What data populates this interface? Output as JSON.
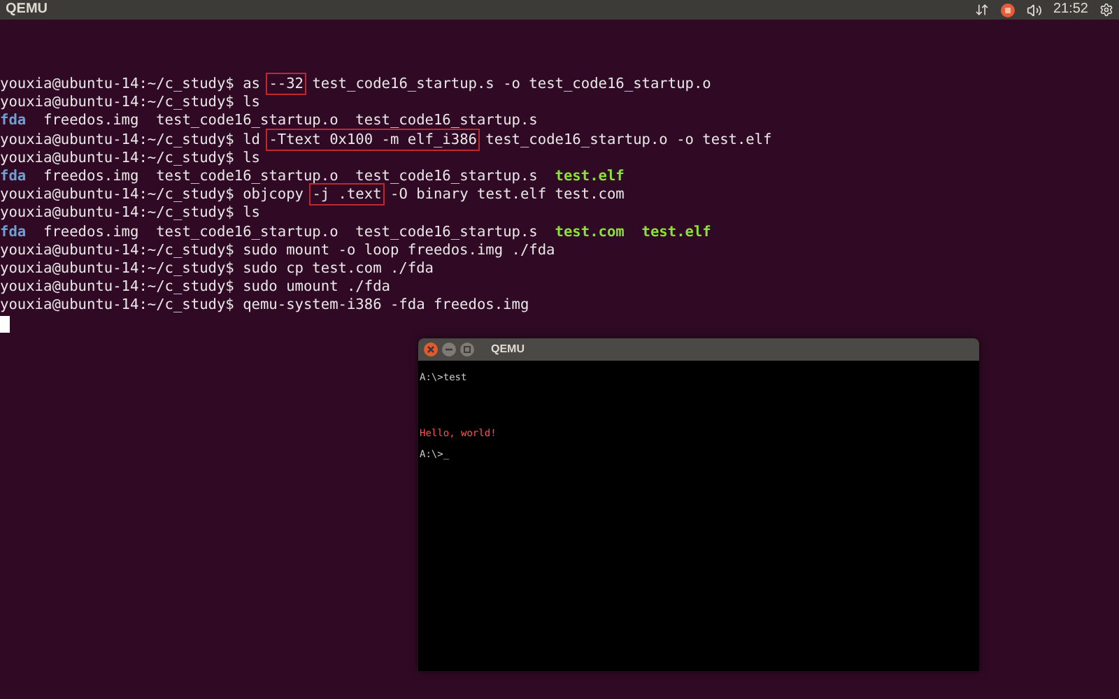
{
  "top_bar": {
    "title": "QEMU",
    "clock": "21:52"
  },
  "terminal": {
    "lines": [
      [
        {
          "kind": "plain",
          "text": "youxia@ubuntu-14:~/c_study$ as "
        },
        {
          "kind": "boxed",
          "text": "--32"
        },
        {
          "kind": "plain",
          "text": " test_code16_startup.s -o test_code16_startup.o"
        }
      ],
      [
        {
          "kind": "plain",
          "text": "youxia@ubuntu-14:~/c_study$ ls"
        }
      ],
      [
        {
          "kind": "dir",
          "text": "fda"
        },
        {
          "kind": "plain",
          "text": "  freedos.img  test_code16_startup.o  test_code16_startup.s"
        }
      ],
      [
        {
          "kind": "plain",
          "text": "youxia@ubuntu-14:~/c_study$ ld "
        },
        {
          "kind": "boxed",
          "text": "-Ttext 0x100 -m elf_i386"
        },
        {
          "kind": "plain",
          "text": " test_code16_startup.o -o test.elf"
        }
      ],
      [
        {
          "kind": "plain",
          "text": "youxia@ubuntu-14:~/c_study$ ls"
        }
      ],
      [
        {
          "kind": "dir",
          "text": "fda"
        },
        {
          "kind": "plain",
          "text": "  freedos.img  test_code16_startup.o  test_code16_startup.s  "
        },
        {
          "kind": "exec",
          "text": "test.elf"
        }
      ],
      [
        {
          "kind": "plain",
          "text": "youxia@ubuntu-14:~/c_study$ objcopy "
        },
        {
          "kind": "boxed",
          "text": "-j .text"
        },
        {
          "kind": "plain",
          "text": " -O binary test.elf test.com"
        }
      ],
      [
        {
          "kind": "plain",
          "text": "youxia@ubuntu-14:~/c_study$ ls"
        }
      ],
      [
        {
          "kind": "dir",
          "text": "fda"
        },
        {
          "kind": "plain",
          "text": "  freedos.img  test_code16_startup.o  test_code16_startup.s  "
        },
        {
          "kind": "exec",
          "text": "test.com"
        },
        {
          "kind": "exec",
          "text": "test.elf"
        }
      ],
      [
        {
          "kind": "plain",
          "text": "youxia@ubuntu-14:~/c_study$ sudo mount -o loop freedos.img ./fda"
        }
      ],
      [
        {
          "kind": "plain",
          "text": "youxia@ubuntu-14:~/c_study$ sudo cp test.com ./fda"
        }
      ],
      [
        {
          "kind": "plain",
          "text": "youxia@ubuntu-14:~/c_study$ sudo umount ./fda"
        }
      ],
      [
        {
          "kind": "plain",
          "text": "youxia@ubuntu-14:~/c_study$ qemu-system-i386 -fda freedos.img"
        }
      ]
    ]
  },
  "qemu_window": {
    "title": "QEMU",
    "lines": [
      {
        "kind": "command",
        "text": "A:\\>test",
        "color": "#c8c8c8"
      },
      {
        "kind": "output",
        "text": "Hello, world!",
        "color": "#ff5050"
      },
      {
        "kind": "prompt",
        "text": "A:\\>_",
        "color": "#c8c8c8"
      }
    ]
  }
}
